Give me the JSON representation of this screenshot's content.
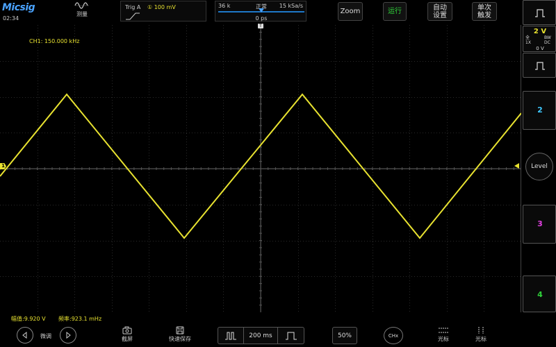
{
  "header": {
    "logo": "Micsig",
    "clock": "02:34",
    "measure_label": "测量"
  },
  "trigger": {
    "label": "Trig  A",
    "level": "① 100 mV"
  },
  "timebase": {
    "memory": "36 k",
    "mode": "正常",
    "sample_rate": "15 kSa/s",
    "position": "0 ps"
  },
  "top_buttons": {
    "zoom": "Zoom",
    "run": "运行",
    "auto_line1": "自动",
    "auto_line2": "设置",
    "single_line1": "单次",
    "single_line2": "触发"
  },
  "channels": {
    "ch1_volts": "2 V",
    "ch1_bw": "全",
    "ch1_probe": "1X",
    "ch1_bw_label": "BW",
    "ch1_coupling": "DC",
    "ch1_offset": "0 V",
    "ch2": "2",
    "ch3": "3",
    "ch4": "4",
    "level_label": "Level",
    "ch1_color": "#e8e230",
    "ch2_color": "#3ec8ff",
    "ch3_color": "#e040e0",
    "ch4_color": "#2fd13a"
  },
  "screen": {
    "freq_readout": "CH1: 150.000 kHz",
    "trig_marker": "T",
    "ch1_marker": "1"
  },
  "measurements": {
    "amplitude": "幅值:9.920 V",
    "frequency": "频率:923.1 mHz"
  },
  "bottom": {
    "fine_label": "微调",
    "screenshot_label": "截屏",
    "quick_save_label": "快速保存",
    "timebase_value": "200 ms",
    "percent": "50%",
    "chx": "CHx",
    "cursor1_label": "光标",
    "cursor2_label": "光标"
  }
}
